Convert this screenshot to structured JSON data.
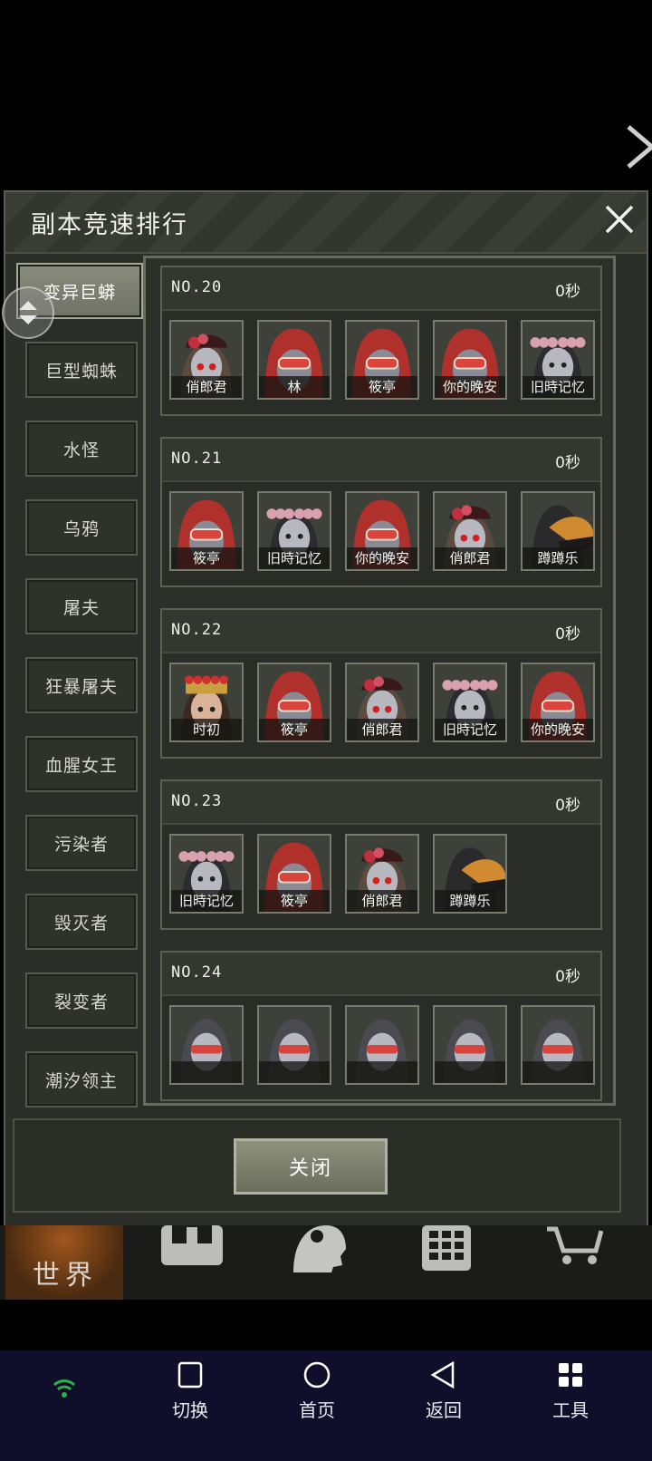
{
  "dialog": {
    "title": "副本竞速排行",
    "close_button": "关闭"
  },
  "tabs": [
    {
      "label": "变异巨蟒",
      "active": true
    },
    {
      "label": "巨型蜘蛛",
      "active": false
    },
    {
      "label": "水怪",
      "active": false
    },
    {
      "label": "乌鸦",
      "active": false
    },
    {
      "label": "屠夫",
      "active": false
    },
    {
      "label": "狂暴屠夫",
      "active": false
    },
    {
      "label": "血腥女王",
      "active": false
    },
    {
      "label": "污染者",
      "active": false
    },
    {
      "label": "毁灭者",
      "active": false
    },
    {
      "label": "裂变者",
      "active": false
    },
    {
      "label": "潮汐领主",
      "active": false
    }
  ],
  "ranks": [
    {
      "no": "NO.20",
      "time": "0秒",
      "members": [
        "俏郎君",
        "林",
        "筱亭",
        "你的晚安",
        "旧時记忆"
      ]
    },
    {
      "no": "NO.21",
      "time": "0秒",
      "members": [
        "筱亭",
        "旧時记忆",
        "你的晚安",
        "俏郎君",
        "蹲蹲乐"
      ]
    },
    {
      "no": "NO.22",
      "time": "0秒",
      "members": [
        "时初",
        "筱亭",
        "俏郎君",
        "旧時记忆",
        "你的晚安"
      ]
    },
    {
      "no": "NO.23",
      "time": "0秒",
      "members": [
        "旧時记忆",
        "筱亭",
        "俏郎君",
        "蹲蹲乐"
      ]
    },
    {
      "no": "NO.24",
      "time": "0秒",
      "members": [
        "",
        "",
        "",
        "",
        ""
      ]
    }
  ],
  "game_nav": {
    "world_label": "世界"
  },
  "system_nav": [
    {
      "label": "切换",
      "icon": "square-icon"
    },
    {
      "label": "首页",
      "icon": "circle-icon"
    },
    {
      "label": "返回",
      "icon": "back-triangle-icon"
    },
    {
      "label": "工具",
      "icon": "grid-icon"
    }
  ],
  "colors": {
    "hood_red": "#b0302c",
    "flower_pink": "#d9a0b0",
    "panel_border": "#676b5c"
  }
}
